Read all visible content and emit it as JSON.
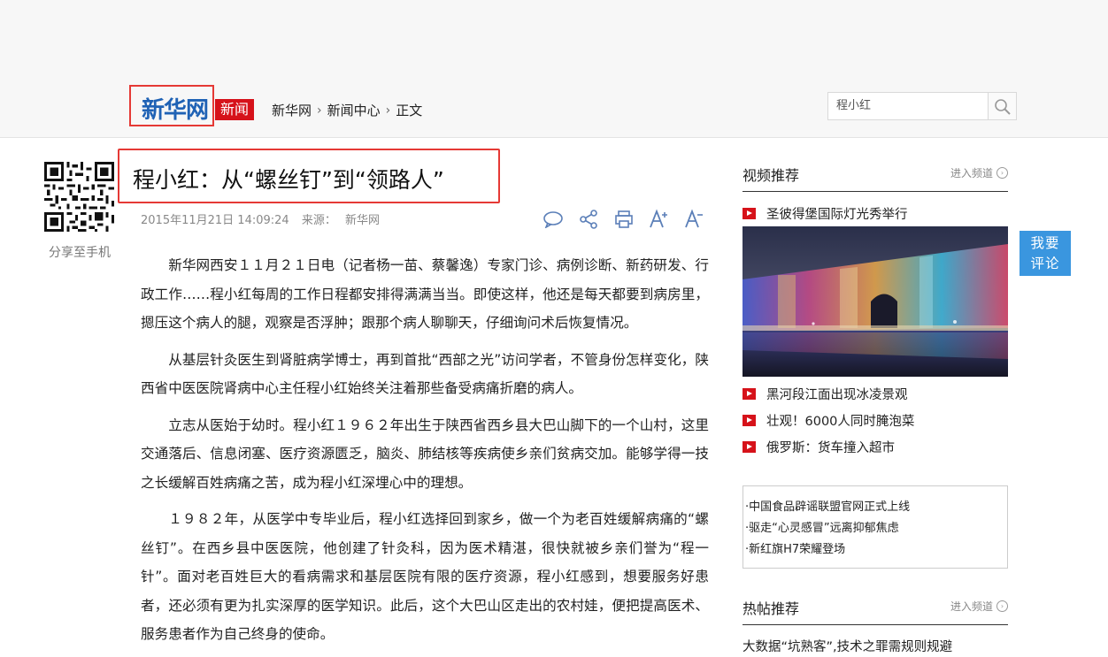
{
  "header": {
    "logo_text": "新华网",
    "logo_tag": "新闻",
    "breadcrumb": [
      "新华网",
      "新闻中心",
      "正文"
    ],
    "search_value": "程小红"
  },
  "share": {
    "label": "分享至手机"
  },
  "article": {
    "title": "程小红：从“螺丝钉”到“领路人”",
    "datetime": "2015年11月21日 14:09:24",
    "source_label": "来源：",
    "source": "新华网",
    "paragraphs": [
      "新华网西安１１月２１日电（记者杨一苗、蔡馨逸）专家门诊、病例诊断、新药研发、行政工作……程小红每周的工作日程都安排得满满当当。即使这样，他还是每天都要到病房里，摁压这个病人的腿，观察是否浮肿；跟那个病人聊聊天，仔细询问术后恢复情况。",
      "从基层针灸医生到肾脏病学博士，再到首批“西部之光”访问学者，不管身份怎样变化，陕西省中医医院肾病中心主任程小红始终关注着那些备受病痛折磨的病人。",
      "立志从医始于幼时。程小红１９６２年出生于陕西省西乡县大巴山脚下的一个山村，这里交通落后、信息闭塞、医疗资源匮乏，脑炎、肺结核等疾病使乡亲们贫病交加。能够学得一技之长缓解百姓病痛之苦，成为程小红深埋心中的理想。",
      "１９８２年，从医学中专毕业后，程小红选择回到家乡，做一个为老百姓缓解病痛的“螺丝钉”。在西乡县中医医院，他创建了针灸科，因为医术精湛，很快就被乡亲们誉为“程一针”。面对老百姓巨大的看病需求和基层医院有限的医疗资源，程小红感到，想要服务好患者，还必须有更为扎实深厚的医学知识。此后，这个大巴山区走出的农村娃，便把提高医术、服务患者作为自己终身的使命。"
    ]
  },
  "sidebar": {
    "video": {
      "title": "视频推荐",
      "more": "进入频道",
      "items": [
        "圣彼得堡国际灯光秀举行",
        "黑河段江面出现冰凌景观",
        "壮观！6000人同时腌泡菜",
        "俄罗斯：货车撞入超市"
      ]
    },
    "ads": [
      "·中国食品辟谣联盟官网正式上线",
      "·驱走“心灵感冒”远离抑郁焦虑",
      "·新红旗H7荣耀登场"
    ],
    "hot": {
      "title": "热帖推荐",
      "more": "进入频道",
      "items": [
        "大数据“坑熟客”,技术之罪需规则规避"
      ]
    }
  },
  "comment_button": {
    "line1": "我要",
    "line2": "评论"
  },
  "colors": {
    "accent_red": "#d6121a",
    "highlight_box": "#e53935",
    "logo_blue": "#1f62b5",
    "comment_blue": "#3a96df"
  }
}
